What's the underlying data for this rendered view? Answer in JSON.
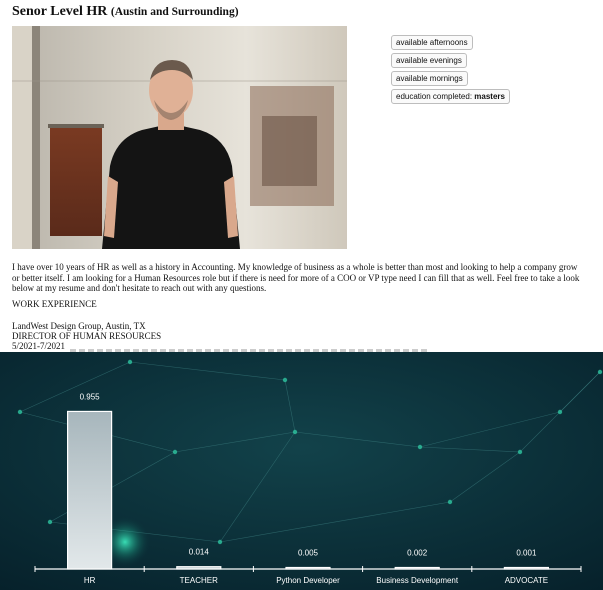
{
  "post": {
    "title_main": "Senor Level HR",
    "title_sub": "(Austin and Surrounding)",
    "tags": [
      {
        "text": "available afternoons"
      },
      {
        "text": "available evenings"
      },
      {
        "text": "available mornings"
      },
      {
        "prefix": "education completed: ",
        "bold": "masters"
      }
    ],
    "description": "I have over 10 years of HR as well as a history in Accounting. My knowledge of business as a whole is better than most and looking to help a company grow or better itself. I am looking for a Human Resources role but if there is need for more of a COO or VP type need I can fill that as well. Feel free to take a look below at my resume and don't hesitate to reach out with any questions.",
    "section_heading": "WORK EXPERIENCE",
    "job": {
      "company": "LandWest Design Group, Austin, TX",
      "role": "DIRECTOR OF HUMAN RESOURCES",
      "dates": "5/2021-7/2021"
    }
  },
  "colors": {
    "background": "#0a2a33",
    "bar_top": "#a7b6bc",
    "bar_bottom": "#e2e8ea",
    "node": "#2ec4a0"
  },
  "chart_data": {
    "type": "bar",
    "categories": [
      "HR",
      "TEACHER",
      "Python Developer",
      "Business Development",
      "ADVOCATE"
    ],
    "values": [
      0.955,
      0.014,
      0.005,
      0.002,
      0.001
    ],
    "value_labels": [
      "0.955",
      "0.014",
      "0.005",
      "0.002",
      "0.001"
    ],
    "ylim": [
      0,
      1
    ],
    "grid": false
  }
}
